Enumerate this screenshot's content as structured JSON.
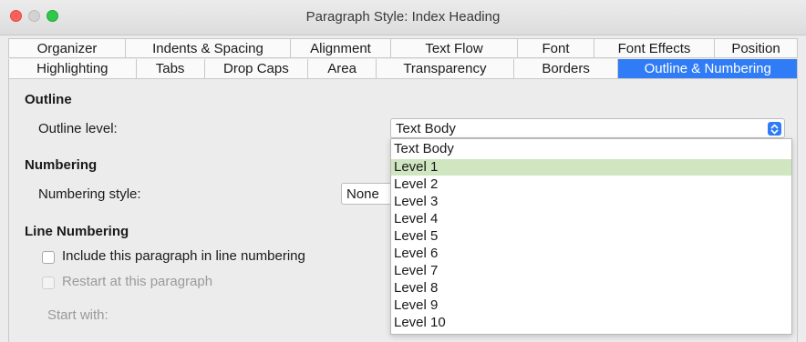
{
  "window": {
    "title": "Paragraph Style: Index Heading"
  },
  "tabs": {
    "row1": [
      {
        "label": "Organizer"
      },
      {
        "label": "Indents & Spacing"
      },
      {
        "label": "Alignment"
      },
      {
        "label": "Text Flow"
      },
      {
        "label": "Font"
      },
      {
        "label": "Font Effects"
      },
      {
        "label": "Position"
      }
    ],
    "row2": [
      {
        "label": "Highlighting"
      },
      {
        "label": "Tabs"
      },
      {
        "label": "Drop Caps"
      },
      {
        "label": "Area"
      },
      {
        "label": "Transparency"
      },
      {
        "label": "Borders"
      },
      {
        "label": "Outline & Numbering"
      }
    ],
    "active": "Outline & Numbering"
  },
  "outline": {
    "section_title": "Outline",
    "level_label": "Outline level:",
    "level_value": "Text Body",
    "options": [
      "Text Body",
      "Level 1",
      "Level 2",
      "Level 3",
      "Level 4",
      "Level 5",
      "Level 6",
      "Level 7",
      "Level 8",
      "Level 9",
      "Level 10"
    ],
    "hovered_option": "Level 1"
  },
  "numbering": {
    "section_title": "Numbering",
    "style_label": "Numbering style:",
    "style_value": "None"
  },
  "line_numbering": {
    "section_title": "Line Numbering",
    "include_label": "Include this paragraph in line numbering",
    "include_checked": false,
    "restart_label": "Restart at this paragraph",
    "restart_checked": false,
    "restart_enabled": false,
    "start_with_label": "Start with:"
  },
  "colors": {
    "accent": "#2f7cf6",
    "hover_highlight": "#cfe6c0"
  }
}
